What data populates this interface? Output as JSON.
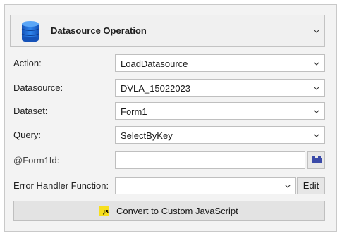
{
  "header": {
    "title": "Datasource Operation",
    "icon": "database-icon"
  },
  "fields": {
    "action": {
      "label": "Action:",
      "value": "LoadDatasource"
    },
    "datasource": {
      "label": "Datasource:",
      "value": "DVLA_15022023"
    },
    "dataset": {
      "label": "Dataset:",
      "value": "Form1"
    },
    "query": {
      "label": "Query:",
      "value": "SelectByKey"
    },
    "param": {
      "label": "@Form1Id:",
      "value": "",
      "picker_icon": "datasource-picker-icon"
    },
    "error_handler": {
      "label": "Error Handler Function:",
      "value": "",
      "edit_label": "Edit"
    }
  },
  "convert": {
    "icon_text": "JS",
    "label": "Convert to Custom JavaScript"
  },
  "colors": {
    "panel_bg": "#f3f3f3",
    "db_blue": "#1e6fd9",
    "js_yellow": "#f7df1e",
    "picker_icon": "#3a4aa8"
  }
}
